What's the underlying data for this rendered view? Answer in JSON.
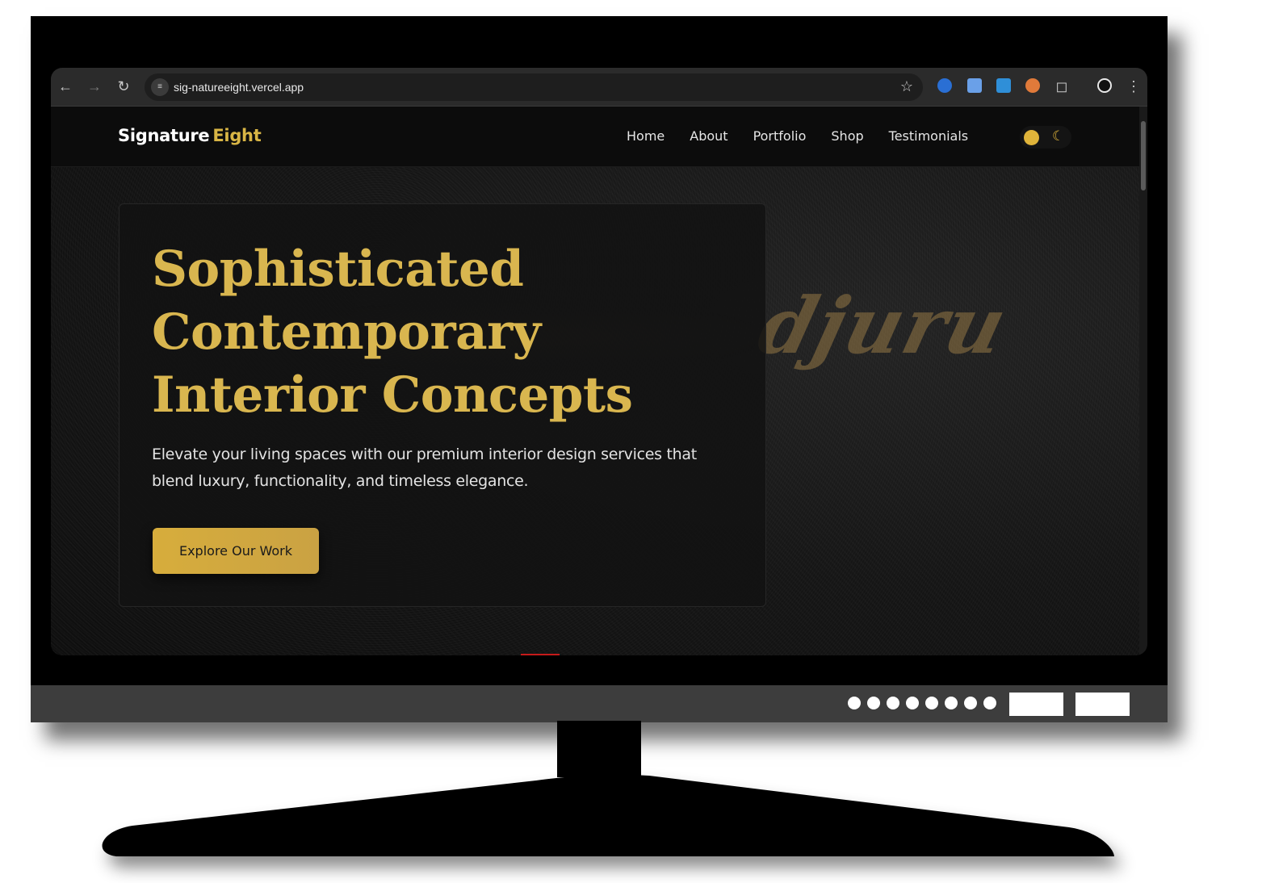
{
  "browser": {
    "url": "sig-natureeight.vercel.app",
    "nav_icons": [
      "back-icon",
      "forward-icon",
      "reload-icon"
    ],
    "toolbar_icons": [
      "bookmark-star-icon",
      "extension-icons",
      "profile-icon",
      "menu-icon"
    ]
  },
  "site": {
    "logo_part1": "Signature",
    "logo_part2": "Eight",
    "nav": [
      "Home",
      "About",
      "Portfolio",
      "Shop",
      "Testimonials"
    ],
    "theme_toggle": {
      "icons": [
        "sun-icon",
        "moon-icon"
      ],
      "active": "light"
    }
  },
  "hero": {
    "title": "Sophisticated Contemporary Interior Concepts",
    "description": "Elevate your living spaces with our premium interior design services that blend luxury, functionality, and timeless elegance.",
    "cta": "Explore Our Work",
    "background_script": "djuru"
  },
  "colors": {
    "accent": "#d9b64f",
    "background": "#0c0c0c",
    "text": "#e3e3e3"
  }
}
